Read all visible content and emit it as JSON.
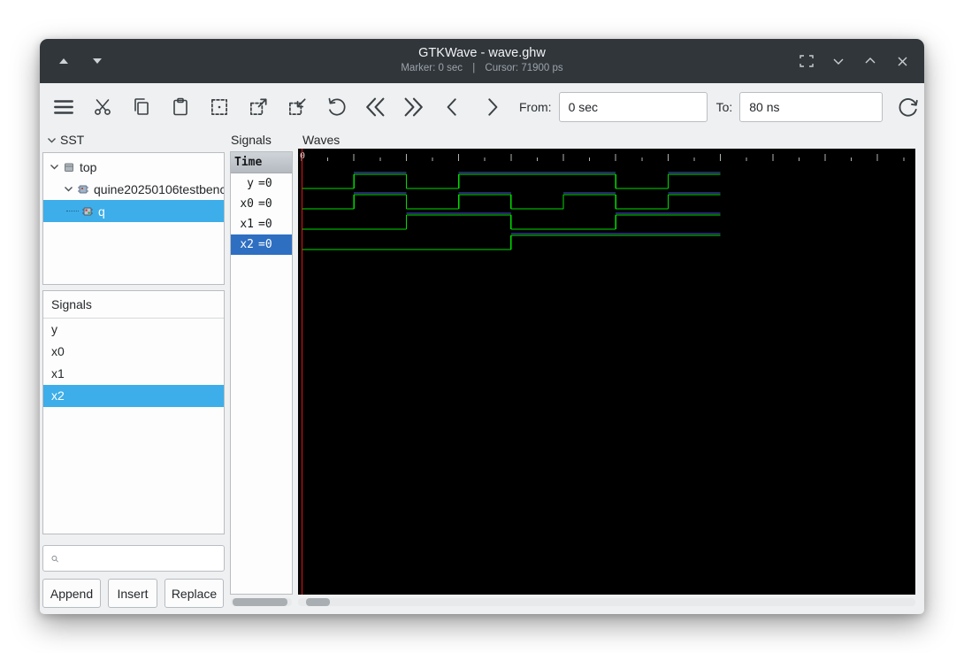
{
  "titlebar": {
    "title": "GTKWave - wave.ghw",
    "marker_text": "Marker: 0 sec",
    "separator": "|",
    "cursor_text": "Cursor: 71900 ps"
  },
  "toolbar": {
    "from_label": "From:",
    "from_value": "0 sec",
    "to_label": "To:",
    "to_value": "80 ns",
    "icons": [
      "menu-icon",
      "cut-icon",
      "copy-icon",
      "paste-icon",
      "zoom-fit-icon",
      "zoom-in-icon",
      "zoom-out-icon",
      "undo-icon",
      "skip-to-start-icon",
      "skip-to-end-icon",
      "step-left-icon",
      "step-right-icon",
      "reload-icon"
    ]
  },
  "sst": {
    "label": "SST",
    "nodes": [
      {
        "label": "top",
        "depth": 0,
        "selected": false
      },
      {
        "label": "quine20250106testbenc",
        "depth": 1,
        "selected": false
      },
      {
        "label": "q",
        "depth": 2,
        "selected": true
      }
    ]
  },
  "signals_list": {
    "label": "Signals",
    "items": [
      {
        "label": "y",
        "selected": false
      },
      {
        "label": "x0",
        "selected": false
      },
      {
        "label": "x1",
        "selected": false
      },
      {
        "label": "x2",
        "selected": true
      }
    ],
    "buttons": {
      "append": "Append",
      "insert": "Insert",
      "replace": "Replace"
    }
  },
  "wave_names": {
    "label": "Signals",
    "time_header": "Time",
    "rows": [
      {
        "name": "y",
        "value": "=0",
        "selected": false
      },
      {
        "name": "x0",
        "value": "=0",
        "selected": false
      },
      {
        "name": "x1",
        "value": "=0",
        "selected": false
      },
      {
        "name": "x2",
        "value": "=0",
        "selected": true
      }
    ]
  },
  "waves": {
    "label": "Waves",
    "origin_label": "0",
    "total_ns": 80,
    "colors": {
      "bg": "#000000",
      "trace": "#00dc00",
      "high_line": "#4a50d8",
      "marker": "#e01414",
      "tick": "#b0b4b0",
      "accent_selection": "#3daee9"
    },
    "signals": [
      {
        "name": "y",
        "segments": [
          [
            0,
            10,
            0
          ],
          [
            10,
            20,
            1
          ],
          [
            20,
            30,
            0
          ],
          [
            30,
            60,
            1
          ],
          [
            60,
            70,
            0
          ],
          [
            70,
            80,
            1
          ]
        ]
      },
      {
        "name": "x0",
        "segments": [
          [
            0,
            10,
            0
          ],
          [
            10,
            20,
            1
          ],
          [
            20,
            30,
            0
          ],
          [
            30,
            40,
            1
          ],
          [
            40,
            50,
            0
          ],
          [
            50,
            60,
            1
          ],
          [
            60,
            70,
            0
          ],
          [
            70,
            80,
            1
          ]
        ]
      },
      {
        "name": "x1",
        "segments": [
          [
            0,
            20,
            0
          ],
          [
            20,
            40,
            1
          ],
          [
            40,
            60,
            0
          ],
          [
            60,
            80,
            1
          ]
        ]
      },
      {
        "name": "x2",
        "segments": [
          [
            0,
            40,
            0
          ],
          [
            40,
            80,
            1
          ]
        ]
      }
    ]
  }
}
